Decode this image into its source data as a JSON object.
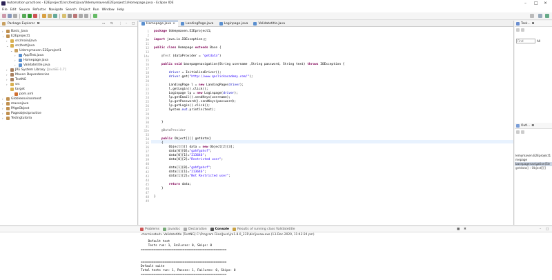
{
  "window": {
    "title": "Automation practices - E2Eproject1/src/test/java/Udemymaven/E2Eproject1/Homepage.java - Eclipse IDE"
  },
  "menu": [
    "File",
    "Edit",
    "Source",
    "Refactor",
    "Navigate",
    "Search",
    "Project",
    "Run",
    "Window",
    "Help"
  ],
  "explorer": {
    "title": "Package Explorer",
    "items": [
      {
        "label": "Basic_Java",
        "depth": 0,
        "arrow": ">",
        "icon": "project"
      },
      {
        "label": "E2Eproject1",
        "depth": 0,
        "arrow": "v",
        "icon": "project"
      },
      {
        "label": "src/main/java",
        "depth": 1,
        "arrow": ">",
        "icon": "folder"
      },
      {
        "label": "src/test/java",
        "depth": 1,
        "arrow": "v",
        "icon": "folder"
      },
      {
        "label": "Udemymaven.E2Eproject1",
        "depth": 2,
        "arrow": "v",
        "icon": "package"
      },
      {
        "label": "AppTest.java",
        "depth": 3,
        "arrow": ">",
        "icon": "java"
      },
      {
        "label": "Homepage.java",
        "depth": 3,
        "arrow": ">",
        "icon": "java"
      },
      {
        "label": "Validatetitle.java",
        "depth": 3,
        "arrow": ">",
        "icon": "java"
      },
      {
        "label": "JRE System Library",
        "suffix": "[JavaSE-1.7]",
        "depth": 1,
        "arrow": ">",
        "icon": "library"
      },
      {
        "label": "Maven Dependencies",
        "depth": 1,
        "arrow": ">",
        "icon": "library"
      },
      {
        "label": "TestNG",
        "depth": 1,
        "arrow": ">",
        "icon": "library"
      },
      {
        "label": "src",
        "depth": 1,
        "arrow": ">",
        "icon": "folder"
      },
      {
        "label": "target",
        "depth": 1,
        "arrow": "",
        "icon": "folder"
      },
      {
        "label": "pom.xml",
        "depth": 2,
        "arrow": "",
        "icon": "xml"
      },
      {
        "label": "Globleenvironment",
        "depth": 0,
        "arrow": ">",
        "icon": "project"
      },
      {
        "label": "mavenjava",
        "depth": 0,
        "arrow": ">",
        "icon": "project"
      },
      {
        "label": "PAgeObject",
        "depth": 0,
        "arrow": ">",
        "icon": "project"
      },
      {
        "label": "Pageobjectpractice",
        "depth": 0,
        "arrow": ">",
        "icon": "project"
      },
      {
        "label": "Testngtutoria",
        "depth": 0,
        "arrow": ">",
        "icon": "project"
      }
    ]
  },
  "editor": {
    "tabs": [
      {
        "label": "Homepage.java",
        "active": true
      },
      {
        "label": "LandingPage.java",
        "active": false
      },
      {
        "label": "Loginpage.java",
        "active": false
      },
      {
        "label": "Validatetitle.java",
        "active": false
      }
    ],
    "lines": [
      {
        "n": "1",
        "html": "<span class='kw'>package</span> Udemymaven.E2Eproject1;"
      },
      {
        "n": "2",
        "html": ""
      },
      {
        "n": "3⊕",
        "html": "<span class='kw'>import</span> java.io.IOException;□"
      },
      {
        "n": "11",
        "html": ""
      },
      {
        "n": "12",
        "html": "<span class='kw'>public class</span> Homepage <span class='kw'>extends</span> Base {"
      },
      {
        "n": "13",
        "html": ""
      },
      {
        "n": "14⊖",
        "html": "    <span class='ann'>@Test</span> (dataProvider = <span class='str'>\"getdata\"</span>)"
      },
      {
        "n": "15",
        "html": ""
      },
      {
        "n": "16",
        "html": "    <span class='kw'>public void</span> basepagenavigation(String username ,String password, String text) <span class='kw'>throws</span> IOException {"
      },
      {
        "n": "17",
        "html": ""
      },
      {
        "n": "18",
        "html": "        <span class='fld'>driver</span> = InitializeDriver();"
      },
      {
        "n": "19",
        "html": "        <span class='fld'>driver</span>.get(<span class='str'>\"http://www.qaclickacademy.com/\"</span>);"
      },
      {
        "n": "20",
        "html": ""
      },
      {
        "n": "21",
        "html": "        LandingPage l = <span class='kw'>new</span> LandingPage(<span class='fld'>driver</span>);"
      },
      {
        "n": "22",
        "html": "        l.getLogin().click();"
      },
      {
        "n": "23",
        "html": "        Loginpage lp = <span class='kw'>new</span> Loginpage(<span class='fld'>driver</span>);"
      },
      {
        "n": "24",
        "html": "        lp.getEmail().sendKeys(username);"
      },
      {
        "n": "25",
        "html": "        lp.getPassword().sendKeys(password);"
      },
      {
        "n": "26",
        "html": "        lp.getLogin().click();"
      },
      {
        "n": "27",
        "html": "        System.<span class='fld'>out</span>.println(text);"
      },
      {
        "n": "28",
        "html": "        "
      },
      {
        "n": "29",
        "html": ""
      },
      {
        "n": "30",
        "html": "    }"
      },
      {
        "n": "31",
        "html": ""
      },
      {
        "n": "32⊖",
        "html": "    <span class='ann'>@DataProvider</span>"
      },
      {
        "n": "33",
        "html": ""
      },
      {
        "n": "34",
        "html": "    <span class='kw'>public</span> Object[][] getdata()"
      },
      {
        "n": "35",
        "html": "    {"
      },
      {
        "n": "36",
        "html": "        Object[][] data = <span class='kw'>new</span> Object[2][3];"
      },
      {
        "n": "37",
        "html": "        data[0][0]=<span class='str'>\"gahfgahsf\"</span>;"
      },
      {
        "n": "38",
        "html": "        data[0][1]=<span class='str'>\"213646\"</span>;"
      },
      {
        "n": "39",
        "html": "        data[0][2]=<span class='str'>\"Restricted user\"</span>;"
      },
      {
        "n": "40",
        "html": ""
      },
      {
        "n": "41",
        "html": "        data[1][0]=<span class='str'>\"gahfgahsf\"</span>;"
      },
      {
        "n": "42",
        "html": "        data[1][1]=<span class='str'>\"213646\"</span>;"
      },
      {
        "n": "43",
        "html": "        data[1][2]=<span class='str'>\"Not Restricted user\"</span>;"
      },
      {
        "n": "44",
        "html": ""
      },
      {
        "n": "45",
        "html": "        <span class='kw'>return</span> data;"
      },
      {
        "n": "46",
        "html": "    }"
      },
      {
        "n": "47",
        "html": ""
      },
      {
        "n": "48",
        "html": "}"
      },
      {
        "n": "49",
        "html": ""
      }
    ]
  },
  "right": {
    "task_title": "Task...",
    "find_placeholder": "Find",
    "all_label": "All",
    "outline_title": "Outl...",
    "outline_items": [
      "lemymaven.E2Eproject1",
      "mepage",
      "basepagenavigation(Str",
      "getdata() : Object[][]"
    ]
  },
  "console": {
    "tabs": [
      "Problems",
      "Javadoc",
      "Declaration",
      "Console",
      "Results of running class Validatetitle"
    ],
    "header": "<terminated> Validatetitle [TestNG] C:\\Program Files\\Java\\jre1.8.0_231\\bin\\javaw.exe (13-Dec-2020, 11:42:24 pm)",
    "lines": [
      "    Default test",
      "    Tests run: 1, Failures: 0, Skips: 0",
      "===============================================",
      "",
      "",
      "===============================================",
      "Default suite",
      "Total tests run: 1, Passes: 1, Failures: 0, Skips: 0",
      "==============================================="
    ]
  },
  "colors": {
    "accent": "#3b6fb6",
    "keyword": "#7f0055",
    "string": "#2a00ff",
    "highlight": "#e8f2fe"
  }
}
